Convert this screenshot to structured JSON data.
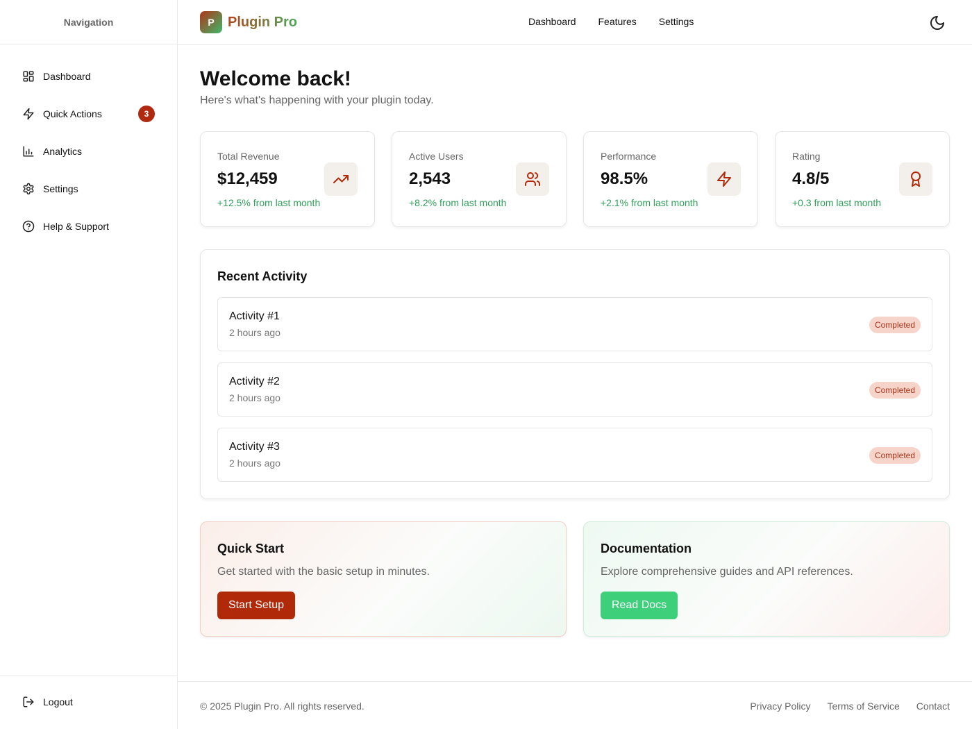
{
  "sidebar": {
    "header": "Navigation",
    "items": [
      {
        "label": "Dashboard",
        "icon": "dashboard-icon"
      },
      {
        "label": "Quick Actions",
        "icon": "lightning-icon",
        "badge": "3"
      },
      {
        "label": "Analytics",
        "icon": "bar-chart-icon"
      },
      {
        "label": "Settings",
        "icon": "gear-icon"
      },
      {
        "label": "Help & Support",
        "icon": "help-circle-icon"
      }
    ],
    "logout": "Logout"
  },
  "header": {
    "logo_letter": "P",
    "brand": "Plugin Pro",
    "nav": [
      "Dashboard",
      "Features",
      "Settings"
    ],
    "theme_icon": "moon-icon"
  },
  "main": {
    "welcome": "Welcome back!",
    "subtitle": "Here's what's happening with your plugin today.",
    "stats": [
      {
        "label": "Total Revenue",
        "value": "$12,459",
        "change": "+12.5% from last month",
        "icon": "trending-up-icon"
      },
      {
        "label": "Active Users",
        "value": "2,543",
        "change": "+8.2% from last month",
        "icon": "users-icon"
      },
      {
        "label": "Performance",
        "value": "98.5%",
        "change": "+2.1% from last month",
        "icon": "lightning-icon"
      },
      {
        "label": "Rating",
        "value": "4.8/5",
        "change": "+0.3 from last month",
        "icon": "award-icon"
      }
    ],
    "activity": {
      "title": "Recent Activity",
      "items": [
        {
          "title": "Activity #1",
          "time": "2 hours ago",
          "status": "Completed"
        },
        {
          "title": "Activity #2",
          "time": "2 hours ago",
          "status": "Completed"
        },
        {
          "title": "Activity #3",
          "time": "2 hours ago",
          "status": "Completed"
        }
      ]
    },
    "quick_start": {
      "title": "Quick Start",
      "text": "Get started with the basic setup in minutes.",
      "button": "Start Setup"
    },
    "documentation": {
      "title": "Documentation",
      "text": "Explore comprehensive guides and API references.",
      "button": "Read Docs"
    }
  },
  "footer": {
    "copyright": "© 2025 Plugin Pro. All rights reserved.",
    "links": [
      "Privacy Policy",
      "Terms of Service",
      "Contact"
    ]
  },
  "colors": {
    "accent": "#b02a0a",
    "success": "#3ecf7a",
    "positive_text": "#2f9e5a",
    "badge_bg": "#f6d4c9"
  }
}
